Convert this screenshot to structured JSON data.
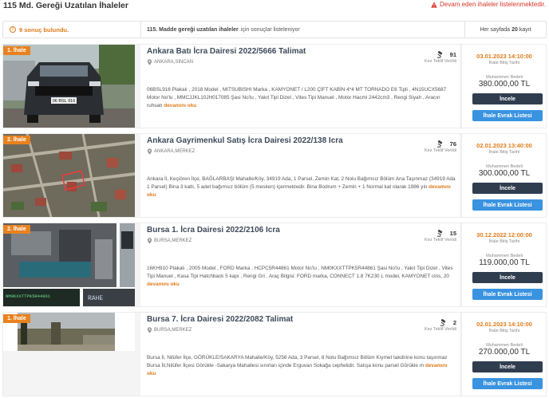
{
  "header": {
    "title": "115 Md. Gereği Uzatılan İhaleler",
    "warning": "Devam eden ihaleler listelenmektedir."
  },
  "infobar": {
    "count": "9 sonuç bulundu.",
    "info_bold": "115. Madde gereği uzatılan ihaleler",
    "info_rest": "için sonuçlar listeleniyor",
    "perpage_pre": "Her sayfada",
    "perpage_num": "20",
    "perpage_post": "kayıt"
  },
  "labels": {
    "bid_label": "Kez Teklif Verildi",
    "date_label": "İhale Bitiş Tarihi",
    "price_label": "Muhammen Bedeli",
    "inspect_button": "İncele",
    "docs_button": "İhale Evrak Listesi",
    "read_more": "devamını oku"
  },
  "listings": [
    {
      "badge": "1. İhale",
      "title": "Ankara Batı İcra Dairesi 2022/5666 Talimat",
      "location": "ANKARA,SİNCAN",
      "bids": "91",
      "date": "03.01.2023 14:10:00",
      "price": "380.000,00 TL",
      "description": "06BSL916 Plakalı , 2018 Model , MITSUBISHI Marka , KAMYONET / L200 ÇİFT KABİN 4*4 MT TORNADO E6 Tipli , 4N15UCX5687 Motor No'lu , MMCJJKL10JH017085 Şasi No'lu , Yakıt Tipi Dizel , Vites Tipi Manuel , Motor Hacmi 2442cm3 , Rengi Siyah , Aracın ruhsatı"
    },
    {
      "badge": "2. İhale",
      "title": "Ankara Gayrimenkul Satış İcra Dairesi 2022/138 Icra",
      "location": "ANKARA,MERKEZ",
      "bids": "76",
      "date": "02.01.2023 13:40:00",
      "price": "300.000,00 TL",
      "description": "Ankara İl, Keçiören İlçe, BAĞLARBAŞI Mahalle/Köy, 34919 Ada, 1 Parsel, Zemin Kat, 2 Nolu Bağımsız Bölüm Ana Taşınmaz (34919 Ada 1 Parsel) Bina 3 katlı, 5 adet bağımsız bölüm (5 mesken) içermektedir. Bina Bodrum + Zemin + 1 Normal kat olarak 1986 yılı"
    },
    {
      "badge": "2. İhale",
      "title": "Bursa 1. İcra Dairesi 2022/2106 Icra",
      "location": "BURSA,MERKEZ",
      "bids": "15",
      "date": "30.12.2022 12:00:00",
      "price": "119.000,00 TL",
      "description": "16KH910 Plakalı , 2005 Model , FORD Marka , HCPC5R44861 Motor No'lu , NM0KXXTTPK5R44861 Şasi No'lu , Yakıt Tipi Dizel , Vites Tipi Manuel , Kasa Tipi Hatchback 5 kapı , Rengi Gri , Araç Bilgisi: FORD marka, CONNECT 1.8 7K230 L model, KAMYONET cins, 20"
    },
    {
      "badge": "1. İhale",
      "title": "Bursa 7. İcra Dairesi 2022/2082 Talimat",
      "location": "BURSA,MERKEZ",
      "bids": "2",
      "date": "02.01.2023 14:10:00",
      "price": "270.000,00 TL",
      "description": "Bursa İl, Nilüfer İlçe, GÖRÜKLE/SAKARYA Mahalle/Köy, 5256 Ada, 3 Parsel, 8 Nolu Bağımsız Bölüm Kıymet takdirine konu taşınmaz Bursa İli,Nilüfer İlçesi Görükle -Sakarya Mahallesi sınırları içinde Erguvan Sokağa cephelidir. Satışa konu parsel Görükle m"
    }
  ],
  "plate_texts": [
    "06 BSL 916",
    "NM0KXXTTPK5R44861",
    "RAHE"
  ],
  "colors": {
    "accent_orange": "#e07b1a",
    "badge_orange": "#e8821f",
    "warning_red": "#d9362b",
    "button_dark": "#2f3d4f",
    "button_blue": "#3a93e0",
    "title_dark": "#3d4a5a"
  }
}
